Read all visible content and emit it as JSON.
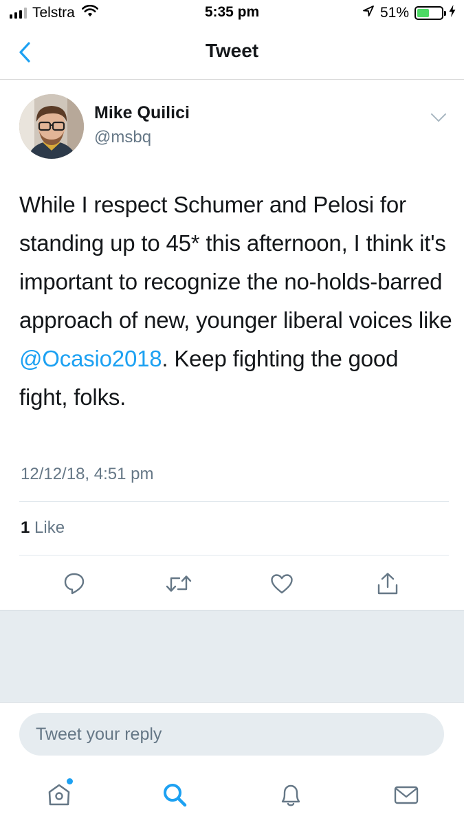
{
  "status_bar": {
    "carrier": "Telstra",
    "time": "5:35 pm",
    "battery": "51%",
    "battery_level": 0.51,
    "icons": [
      "signal-icon",
      "wifi-icon",
      "location-icon",
      "battery-icon",
      "charging-icon"
    ]
  },
  "nav": {
    "title": "Tweet",
    "back_icon": "chevron-left-icon"
  },
  "tweet": {
    "author_name": "Mike Quilici",
    "author_handle": "@msbq",
    "text_before": "While I respect Schumer and Pelosi for standing up to 45* this afternoon, I think it's important to recognize the no-holds-barred approach of new, younger liberal voices like ",
    "mention": "@Ocasio2018",
    "text_after": ". Keep fighting the good fight, folks.",
    "timestamp": "12/12/18, 4:51 pm",
    "like_count": "1",
    "like_label": "Like"
  },
  "actions": [
    "reply-icon",
    "retweet-icon",
    "like-icon",
    "share-icon"
  ],
  "reply": {
    "placeholder": "Tweet your reply"
  },
  "tab_bar": [
    "home-icon",
    "search-icon",
    "notifications-icon",
    "messages-icon"
  ],
  "colors": {
    "accent": "#1da1f2",
    "secondary_text": "#657786",
    "divider": "#e1e8ed",
    "battery_green": "#4cd964"
  }
}
